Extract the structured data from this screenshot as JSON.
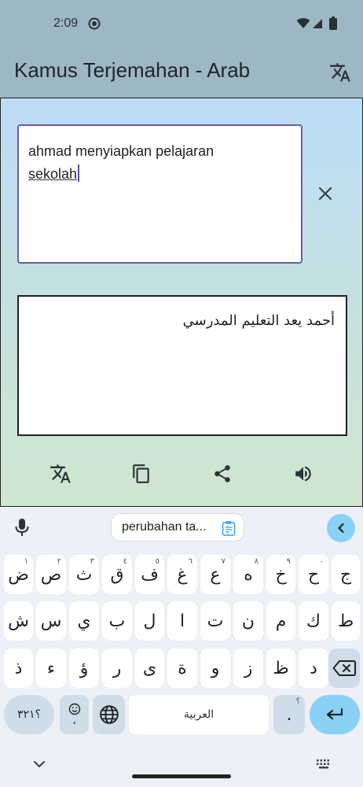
{
  "status_bar": {
    "time": "2:09"
  },
  "app_bar": {
    "title": "Kamus Terjemahan - Arab"
  },
  "input": {
    "line1": "ahmad menyiapkan pelajaran",
    "line2": "sekolah"
  },
  "output": {
    "text": "أحمد يعد التعليم المدرسي"
  },
  "keyboard": {
    "suggestion_chip": "perubahan ta...",
    "row1": [
      {
        "char": "ض",
        "hint": "١"
      },
      {
        "char": "ص",
        "hint": "٢"
      },
      {
        "char": "ث",
        "hint": "٣"
      },
      {
        "char": "ق",
        "hint": "٤"
      },
      {
        "char": "ف",
        "hint": "٥"
      },
      {
        "char": "غ",
        "hint": "٦"
      },
      {
        "char": "ع",
        "hint": "٧"
      },
      {
        "char": "ه",
        "hint": "٨"
      },
      {
        "char": "خ",
        "hint": "٩"
      },
      {
        "char": "ح",
        "hint": "٠"
      },
      {
        "char": "ج",
        "hint": ""
      }
    ],
    "row2": [
      "ش",
      "س",
      "ي",
      "ب",
      "ل",
      "ا",
      "ت",
      "ن",
      "م",
      "ك",
      "ط"
    ],
    "row3": [
      "ذ",
      "ء",
      "ؤ",
      "ر",
      "ى",
      "ة",
      "و",
      "ز",
      "ظ",
      "د"
    ],
    "symbols_label": "؟٣٢١",
    "emoji_sub": "،",
    "space_label": "العربية",
    "period_label": ".",
    "period_hint": "؟"
  },
  "colors": {
    "accent": "#6a5aa6",
    "keyboard_accent": "#8ad1f5",
    "app_bar": "#9db8c4"
  }
}
